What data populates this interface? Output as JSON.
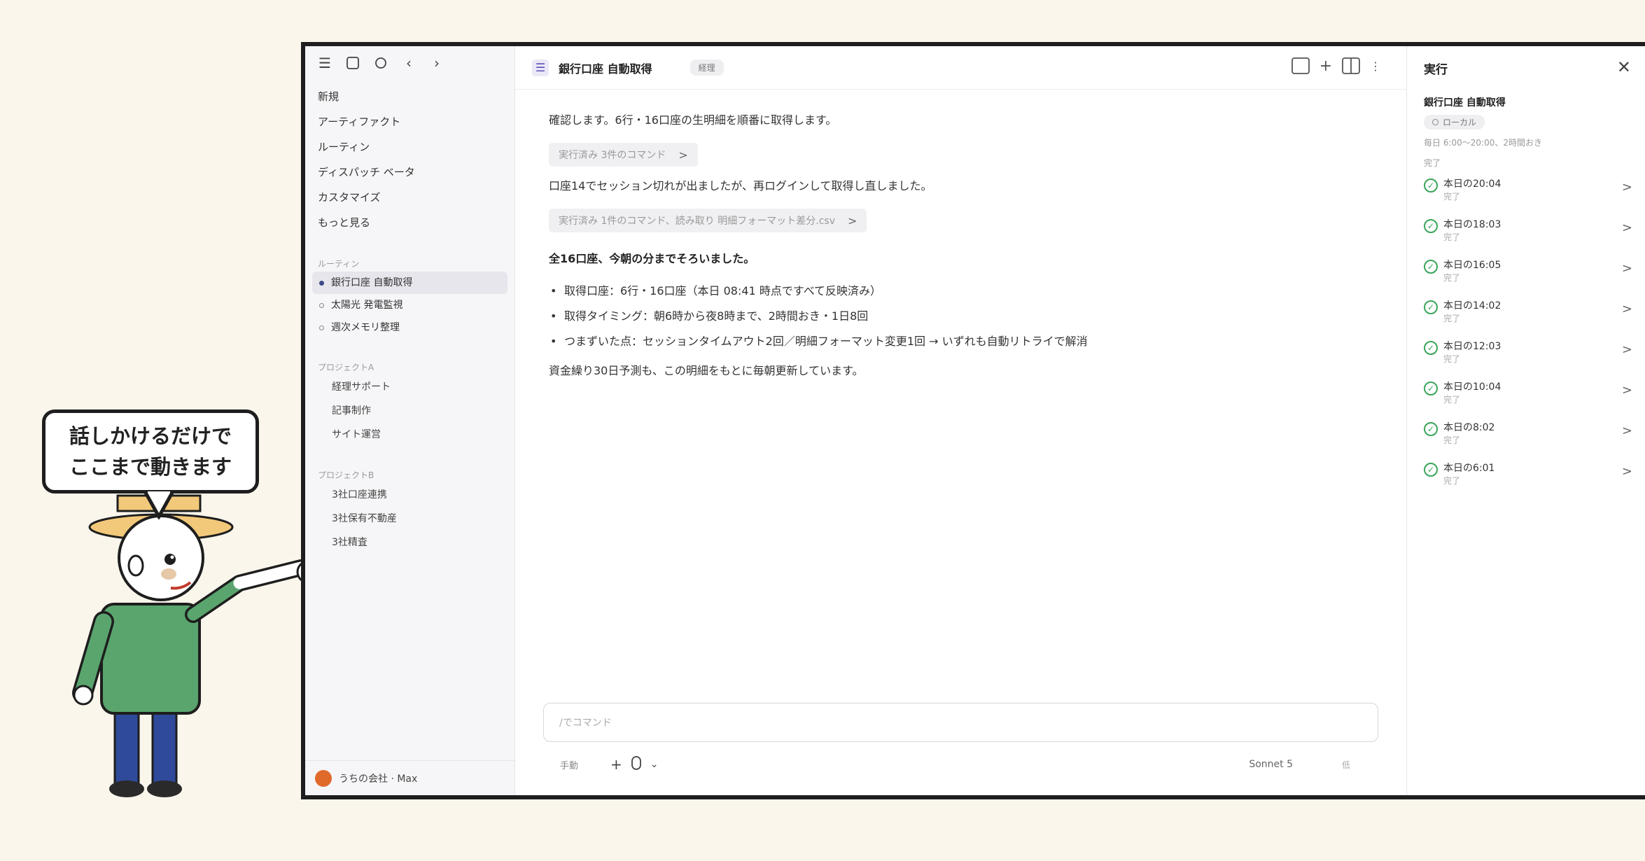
{
  "bubble": {
    "line1": "話しかけるだけで",
    "line2": "ここまで動きます"
  },
  "sidebar": {
    "top_icons": [
      "menu-icon",
      "square-icon",
      "circle-icon",
      "back-arrow-icon",
      "forward-arrow-icon"
    ],
    "nav": [
      "新規",
      "アーティファクト",
      "ルーティン",
      "ディスパッチ ベータ",
      "カスタマイズ",
      "もっと見る"
    ],
    "routines_label": "ルーティン",
    "routines": [
      {
        "label": "銀行口座 自動取得",
        "active": true
      },
      {
        "label": "太陽光 発電監視",
        "active": false
      },
      {
        "label": "週次メモリ整理",
        "active": false
      }
    ],
    "project_a_label": "プロジェクトA",
    "project_a": [
      "経理サポート",
      "記事制作",
      "サイト運営"
    ],
    "project_b_label": "プロジェクトB",
    "project_b": [
      "3社口座連携",
      "3社保有不動産",
      "3社精査"
    ],
    "footer": "うちの会社 · Max"
  },
  "main": {
    "title": "銀行口座 自動取得",
    "tag": "経理",
    "msg1": "確認します。6行・16口座の生明細を順番に取得します。",
    "chip1": "実行済み 3件のコマンド",
    "msg2": "口座14でセッション切れが出ましたが、再ログインして取得し直しました。",
    "chip2": "実行済み 1件のコマンド、読み取り 明細フォーマット差分.csv",
    "bold": "全16口座、今朝の分までそろいました。",
    "bullets": [
      "取得口座：6行・16口座（本日 08:41 時点ですべて反映済み）",
      "取得タイミング：朝6時から夜8時まで、2時間おき・1日8回",
      "つまずいた点：セッションタイムアウト2回／明細フォーマット変更1回 → いずれも自動リトライで解消"
    ],
    "msg3": "資金繰り30日予測も、この明細をもとに毎朝更新しています。",
    "composer_placeholder": "/でコマンド",
    "mode": "手動",
    "model": "Sonnet 5",
    "effort": "低"
  },
  "run": {
    "header": "実行",
    "title": "銀行口座 自動取得",
    "badge": "ローカル",
    "schedule": "毎日 6:00〜20:00、2時間おき",
    "status_top": "完了",
    "runs": [
      {
        "label": "本日の20:04",
        "status": "完了"
      },
      {
        "label": "本日の18:03",
        "status": "完了"
      },
      {
        "label": "本日の16:05",
        "status": "完了"
      },
      {
        "label": "本日の14:02",
        "status": "完了"
      },
      {
        "label": "本日の12:03",
        "status": "完了"
      },
      {
        "label": "本日の10:04",
        "status": "完了"
      },
      {
        "label": "本日の8:02",
        "status": "完了"
      },
      {
        "label": "本日の6:01",
        "status": "完了"
      }
    ]
  },
  "colors": {
    "accent": "#3a4a8a",
    "success": "#3aa55a",
    "avatar": "#e06a2a",
    "background": "#faf6ec"
  }
}
